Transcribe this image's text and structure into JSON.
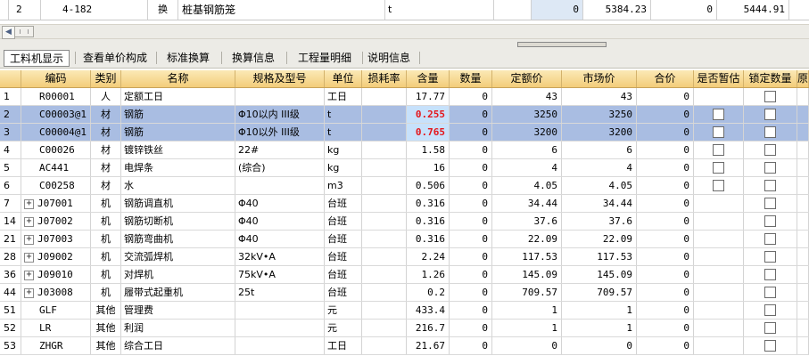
{
  "top_row": {
    "index": "2",
    "code": "4-182",
    "type": "换",
    "name": "桩基钢筋笼",
    "unit": "t",
    "v1": "0",
    "v2": "5384.23",
    "v3": "0",
    "v4": "5444.91"
  },
  "tabs": [
    {
      "label": "工料机显示",
      "active": true
    },
    {
      "label": "查看单价构成",
      "active": false
    },
    {
      "label": "标准换算",
      "active": false
    },
    {
      "label": "换算信息",
      "active": false
    },
    {
      "label": "工程量明细",
      "active": false
    },
    {
      "label": "说明信息",
      "active": false
    }
  ],
  "columns": [
    "编码",
    "类别",
    "名称",
    "规格及型号",
    "单位",
    "损耗率",
    "含量",
    "数量",
    "定额价",
    "市场价",
    "合价",
    "是否暂估",
    "锁定数量",
    "原"
  ],
  "rows": [
    {
      "idx": "1",
      "expand": false,
      "code": "R00001",
      "cat": "人",
      "name": "定额工日",
      "spec": "",
      "unit": "工日",
      "loss": "",
      "content": "17.77",
      "qty": "0",
      "quota": "43",
      "market": "43",
      "total": "0",
      "est": false,
      "lock": true,
      "sel": false,
      "red": false
    },
    {
      "idx": "2",
      "expand": false,
      "code": "C00003@1",
      "cat": "材",
      "name": "钢筋",
      "spec": "Φ10以内 III级",
      "unit": "t",
      "loss": "",
      "content": "0.255",
      "qty": "0",
      "quota": "3250",
      "market": "3250",
      "total": "0",
      "est": true,
      "lock": true,
      "sel": true,
      "red": true
    },
    {
      "idx": "3",
      "expand": false,
      "code": "C00004@1",
      "cat": "材",
      "name": "钢筋",
      "spec": "Φ10以外 III级",
      "unit": "t",
      "loss": "",
      "content": "0.765",
      "qty": "0",
      "quota": "3200",
      "market": "3200",
      "total": "0",
      "est": true,
      "lock": true,
      "sel": true,
      "red": true
    },
    {
      "idx": "4",
      "expand": false,
      "code": "C00026",
      "cat": "材",
      "name": "镀锌铁丝",
      "spec": "22#",
      "unit": "kg",
      "loss": "",
      "content": "1.58",
      "qty": "0",
      "quota": "6",
      "market": "6",
      "total": "0",
      "est": true,
      "lock": true,
      "sel": false,
      "red": false
    },
    {
      "idx": "5",
      "expand": false,
      "code": "AC441",
      "cat": "材",
      "name": "电焊条",
      "spec": "(综合)",
      "unit": "kg",
      "loss": "",
      "content": "16",
      "qty": "0",
      "quota": "4",
      "market": "4",
      "total": "0",
      "est": true,
      "lock": true,
      "sel": false,
      "red": false
    },
    {
      "idx": "6",
      "expand": false,
      "code": "C00258",
      "cat": "材",
      "name": "水",
      "spec": "",
      "unit": "m3",
      "loss": "",
      "content": "0.506",
      "qty": "0",
      "quota": "4.05",
      "market": "4.05",
      "total": "0",
      "est": true,
      "lock": true,
      "sel": false,
      "red": false
    },
    {
      "idx": "7",
      "expand": true,
      "code": "J07001",
      "cat": "机",
      "name": "钢筋调直机",
      "spec": "Φ40",
      "unit": "台班",
      "loss": "",
      "content": "0.316",
      "qty": "0",
      "quota": "34.44",
      "market": "34.44",
      "total": "0",
      "est": false,
      "lock": true,
      "sel": false,
      "red": false
    },
    {
      "idx": "14",
      "expand": true,
      "code": "J07002",
      "cat": "机",
      "name": "钢筋切断机",
      "spec": "Φ40",
      "unit": "台班",
      "loss": "",
      "content": "0.316",
      "qty": "0",
      "quota": "37.6",
      "market": "37.6",
      "total": "0",
      "est": false,
      "lock": true,
      "sel": false,
      "red": false
    },
    {
      "idx": "21",
      "expand": true,
      "code": "J07003",
      "cat": "机",
      "name": "钢筋弯曲机",
      "spec": "Φ40",
      "unit": "台班",
      "loss": "",
      "content": "0.316",
      "qty": "0",
      "quota": "22.09",
      "market": "22.09",
      "total": "0",
      "est": false,
      "lock": true,
      "sel": false,
      "red": false
    },
    {
      "idx": "28",
      "expand": true,
      "code": "J09002",
      "cat": "机",
      "name": "交流弧焊机",
      "spec": "32kV•A",
      "unit": "台班",
      "loss": "",
      "content": "2.24",
      "qty": "0",
      "quota": "117.53",
      "market": "117.53",
      "total": "0",
      "est": false,
      "lock": true,
      "sel": false,
      "red": false
    },
    {
      "idx": "36",
      "expand": true,
      "code": "J09010",
      "cat": "机",
      "name": "对焊机",
      "spec": "75kV•A",
      "unit": "台班",
      "loss": "",
      "content": "1.26",
      "qty": "0",
      "quota": "145.09",
      "market": "145.09",
      "total": "0",
      "est": false,
      "lock": true,
      "sel": false,
      "red": false
    },
    {
      "idx": "44",
      "expand": true,
      "code": "J03008",
      "cat": "机",
      "name": "履带式起重机",
      "spec": "25t",
      "unit": "台班",
      "loss": "",
      "content": "0.2",
      "qty": "0",
      "quota": "709.57",
      "market": "709.57",
      "total": "0",
      "est": false,
      "lock": true,
      "sel": false,
      "red": false
    },
    {
      "idx": "51",
      "expand": false,
      "code": "GLF",
      "cat": "其他",
      "name": "管理费",
      "spec": "",
      "unit": "元",
      "loss": "",
      "content": "433.4",
      "qty": "0",
      "quota": "1",
      "market": "1",
      "total": "0",
      "est": false,
      "lock": true,
      "sel": false,
      "red": false
    },
    {
      "idx": "52",
      "expand": false,
      "code": "LR",
      "cat": "其他",
      "name": "利润",
      "spec": "",
      "unit": "元",
      "loss": "",
      "content": "216.7",
      "qty": "0",
      "quota": "1",
      "market": "1",
      "total": "0",
      "est": false,
      "lock": true,
      "sel": false,
      "red": false
    },
    {
      "idx": "53",
      "expand": false,
      "code": "ZHGR",
      "cat": "其他",
      "name": "综合工日",
      "spec": "",
      "unit": "工日",
      "loss": "",
      "content": "21.67",
      "qty": "0",
      "quota": "0",
      "market": "0",
      "total": "0",
      "est": false,
      "lock": true,
      "sel": false,
      "red": false
    }
  ]
}
